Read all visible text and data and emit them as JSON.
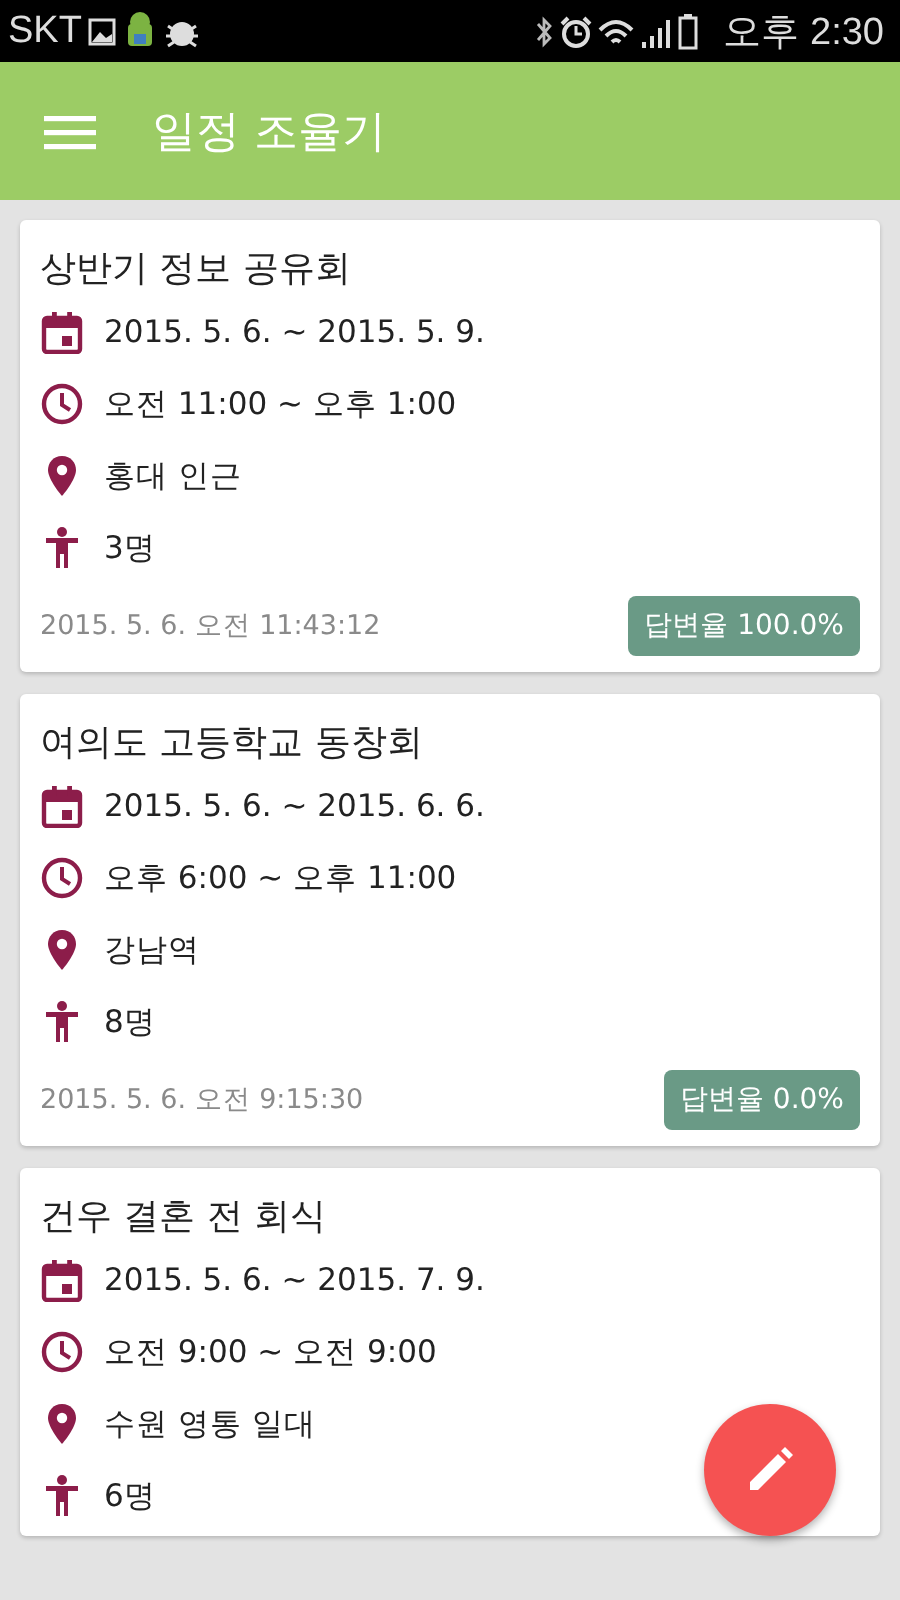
{
  "status_bar": {
    "carrier": "SKT",
    "time": "오후 2:30"
  },
  "app_bar": {
    "title": "일정 조율기"
  },
  "events": [
    {
      "title": "상반기 정보 공유회",
      "date_range": "2015. 5. 6. ~ 2015. 5. 9.",
      "time_range": "오전 11:00 ~ 오후 1:00",
      "place": "홍대 인근",
      "people": "3명",
      "created": "2015. 5. 6. 오전 11:43:12",
      "response_rate": "답변율 100.0%"
    },
    {
      "title": "여의도 고등학교 동창회",
      "date_range": "2015. 5. 6. ~ 2015. 6. 6.",
      "time_range": "오후 6:00 ~ 오후 11:00",
      "place": "강남역",
      "people": "8명",
      "created": "2015. 5. 6. 오전 9:15:30",
      "response_rate": "답변율 0.0%"
    },
    {
      "title": "건우 결혼 전 회식",
      "date_range": "2015. 5. 6. ~ 2015. 7. 9.",
      "time_range": "오전 9:00 ~ 오전 9:00",
      "place": "수원 영통 일대",
      "people": "6명"
    }
  ]
}
